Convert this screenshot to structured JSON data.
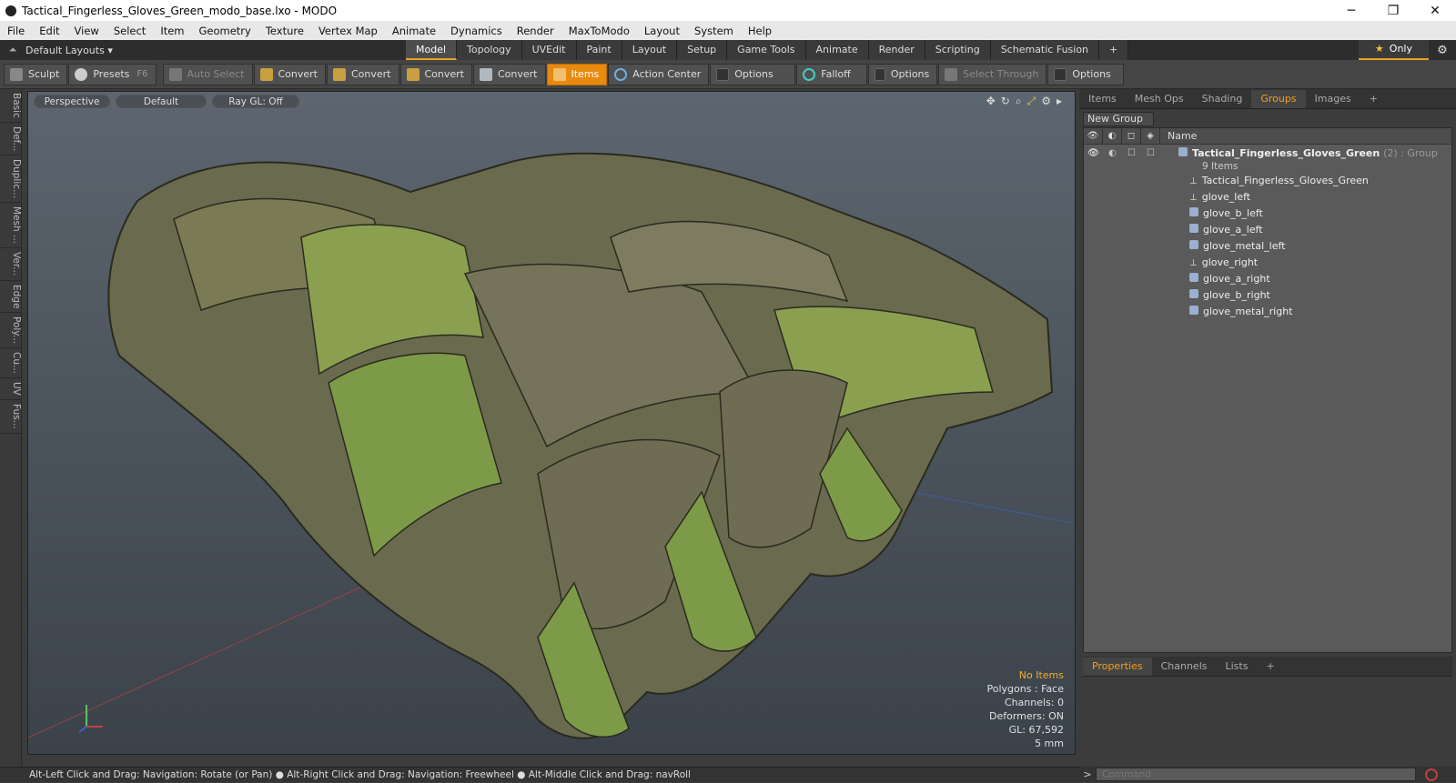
{
  "window": {
    "title": "Tactical_Fingerless_Gloves_Green_modo_base.lxo - MODO"
  },
  "menu": [
    "File",
    "Edit",
    "View",
    "Select",
    "Item",
    "Geometry",
    "Texture",
    "Vertex Map",
    "Animate",
    "Dynamics",
    "Render",
    "MaxToModo",
    "Layout",
    "System",
    "Help"
  ],
  "layout": {
    "selector": "Default Layouts",
    "tabs": [
      "Model",
      "Topology",
      "UVEdit",
      "Paint",
      "Layout",
      "Setup",
      "Game Tools",
      "Animate",
      "Render",
      "Scripting",
      "Schematic Fusion"
    ],
    "active_tab": "Model",
    "only_label": "Only"
  },
  "toolbar": {
    "sculpt": "Sculpt",
    "presets": "Presets",
    "presets_key": "F6",
    "auto_select": "Auto Select",
    "convert1": "Convert",
    "convert2": "Convert",
    "convert3": "Convert",
    "convert4": "Convert",
    "items": "Items",
    "action_center": "Action Center",
    "options1": "Options",
    "falloff": "Falloff",
    "options2": "Options",
    "select_through": "Select Through",
    "options3": "Options"
  },
  "left_tabs": [
    "Basic",
    "Def...",
    "Duplic...",
    "Mesh ...",
    "Ver...",
    "Edge",
    "Poly...",
    "Cu...",
    "UV",
    "Fus..."
  ],
  "viewport": {
    "perspective": "Perspective",
    "default": "Default",
    "raygl": "Ray GL: Off",
    "info": {
      "no_items": "No Items",
      "polygons": "Polygons : Face",
      "channels": "Channels: 0",
      "deformers": "Deformers: ON",
      "gl": "GL: 67,592",
      "scale": "5 mm"
    }
  },
  "right_panel": {
    "tabs": [
      "Items",
      "Mesh Ops",
      "Shading",
      "Groups",
      "Images"
    ],
    "active_tab": "Groups",
    "new_group": "New Group",
    "name_header": "Name",
    "group_name": "Tactical_Fingerless_Gloves_Green",
    "group_suffix": "(2) : Group",
    "group_count": "9 Items",
    "items": [
      "Tactical_Fingerless_Gloves_Green",
      "glove_left",
      "glove_b_left",
      "glove_a_left",
      "glove_metal_left",
      "glove_right",
      "glove_a_right",
      "glove_b_right",
      "glove_metal_right"
    ],
    "bottom_tabs": [
      "Properties",
      "Channels",
      "Lists"
    ],
    "bottom_active": "Properties"
  },
  "status": {
    "text": "Alt-Left Click and Drag: Navigation: Rotate (or Pan) ● Alt-Right Click and Drag: Navigation: Freewheel ● Alt-Middle Click and Drag: navRoll"
  },
  "command": {
    "placeholder": "Command"
  }
}
